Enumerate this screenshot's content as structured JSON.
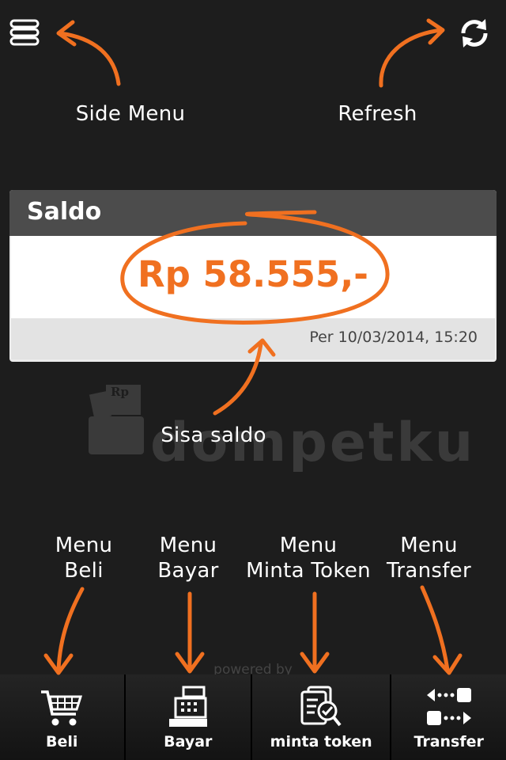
{
  "header": {
    "menu_icon": "hamburger-icon",
    "refresh_icon": "refresh-icon",
    "side_menu_annotation": "Side Menu",
    "refresh_annotation": "Refresh"
  },
  "balance": {
    "title": "Saldo",
    "amount": "Rp 58.555,-",
    "updated": "Per  10/03/2014, 15:20",
    "annotation": "Sisa saldo"
  },
  "brand": {
    "logo_text": "dompetku",
    "logo_badge": "Rp"
  },
  "menu_annotations": {
    "beli": "Menu\nBeli",
    "bayar": "Menu\nBayar",
    "token": "Menu\nMinta Token",
    "transfer": "Menu\nTransfer"
  },
  "footer": {
    "powered": "powered by"
  },
  "tabs": [
    {
      "label": "Beli",
      "icon": "cart-icon"
    },
    {
      "label": "Bayar",
      "icon": "cash-register-icon"
    },
    {
      "label": "minta token",
      "icon": "token-request-icon"
    },
    {
      "label": "Transfer",
      "icon": "transfer-icon"
    }
  ],
  "colors": {
    "accent": "#f07020",
    "background": "#1d1d1d",
    "card_header": "#4c4c4c"
  }
}
